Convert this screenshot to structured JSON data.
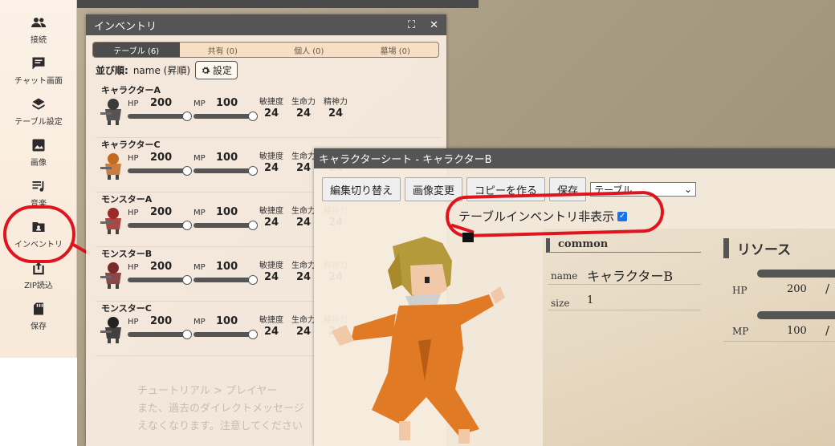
{
  "sidebar": {
    "items": [
      {
        "label": "接続",
        "icon": "users-icon"
      },
      {
        "label": "チャット画面",
        "icon": "chat-icon"
      },
      {
        "label": "テーブル設定",
        "icon": "layers-icon"
      },
      {
        "label": "画像",
        "icon": "image-icon"
      },
      {
        "label": "音楽",
        "icon": "music-list-icon"
      },
      {
        "label": "インベントリ",
        "icon": "inventory-folder-icon"
      },
      {
        "label": "ZIP読込",
        "icon": "upload-icon"
      },
      {
        "label": "保存",
        "icon": "sd-card-icon"
      }
    ]
  },
  "inventory": {
    "title": "インベントリ",
    "tabs": [
      "テーブル (6)",
      "共有 (0)",
      "個人 (0)",
      "墓場 (0)"
    ],
    "sort_label": "並び順:",
    "sort_value": "name (昇順)",
    "settings_label": "設定",
    "stat_labels": {
      "hp": "HP",
      "mp": "MP",
      "agi": "敏捷度",
      "vit": "生命力",
      "spi": "精神力"
    },
    "characters": [
      {
        "name": "キャラクターA",
        "hp": "200",
        "mp": "100",
        "agi": "24",
        "vit": "24",
        "spi": "24"
      },
      {
        "name": "キャラクターC",
        "hp": "200",
        "mp": "100",
        "agi": "24",
        "vit": "24",
        "spi": "24"
      },
      {
        "name": "モンスターA",
        "hp": "200",
        "mp": "100",
        "agi": "24",
        "vit": "24",
        "spi": "24"
      },
      {
        "name": "モンスターB",
        "hp": "200",
        "mp": "100",
        "agi": "24",
        "vit": "24",
        "spi": "24"
      },
      {
        "name": "モンスターC",
        "hp": "200",
        "mp": "100",
        "agi": "24",
        "vit": "24",
        "spi": "24"
      }
    ]
  },
  "sheet": {
    "title": "キャラクターシート - キャラクターB",
    "buttons": [
      "編集切り替え",
      "画像変更",
      "コピーを作る",
      "保存"
    ],
    "select_value": "テーブル",
    "hide_label": "テーブルインベントリ非表示",
    "common_title": "common",
    "name_label": "name",
    "name_value": "キャラクターB",
    "size_label": "size",
    "size_value": "1",
    "resource_title": "リソース",
    "hp_label": "HP",
    "hp_value": "200",
    "mp_label": "MP",
    "mp_value": "100",
    "slash": "/"
  },
  "background_text": {
    "chat_line1": "チュートリアル > プレイヤー",
    "chat_line2": "また、過去のダイレクトメッセージ",
    "chat_line3": "えなくなります。注意してください"
  },
  "colors": {
    "annotation": "#e0141e",
    "header": "#555555",
    "checkbox": "#1a73e8"
  }
}
